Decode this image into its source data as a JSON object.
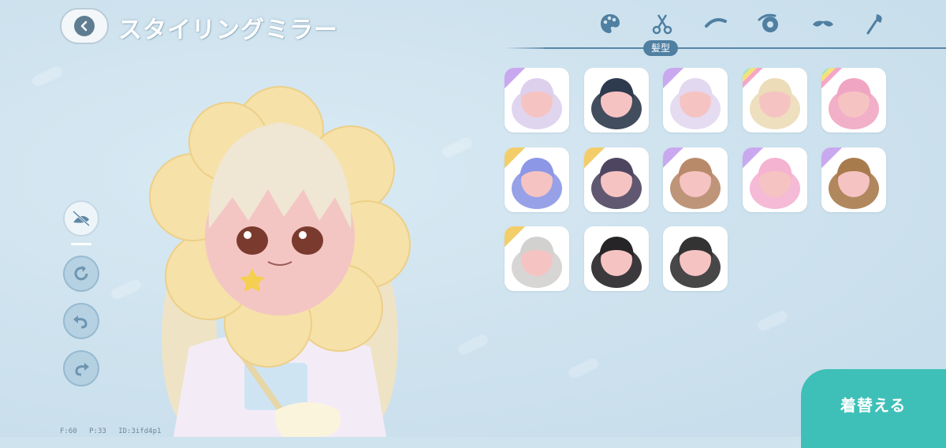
{
  "header": {
    "title": "スタイリングミラー"
  },
  "tabs": {
    "items": [
      {
        "icon": "palette-icon"
      },
      {
        "icon": "scissors-icon"
      },
      {
        "icon": "eyebrow-icon"
      },
      {
        "icon": "eye-icon"
      },
      {
        "icon": "mustache-icon"
      },
      {
        "icon": "brush-icon"
      }
    ],
    "active_label": "髪型"
  },
  "hair_items": [
    {
      "style": "lavender-twin-buns",
      "hair": "#ddd0ec",
      "corner": "purple"
    },
    {
      "style": "black-spiky",
      "hair": "#2e3a4d",
      "corner": "none"
    },
    {
      "style": "lavender-curly",
      "hair": "#e2d8ef",
      "corner": "purple"
    },
    {
      "style": "blonde-long-twin",
      "hair": "#ecdcb8",
      "corner": "rainbow"
    },
    {
      "style": "pink-shaggy",
      "hair": "#f0a6c2",
      "corner": "rainbow"
    },
    {
      "style": "blue-purple-bob",
      "hair": "#8c97e6",
      "corner": "gold"
    },
    {
      "style": "dark-purple-long",
      "hair": "#4e4661",
      "corner": "gold"
    },
    {
      "style": "brown-wavy-long",
      "hair": "#b88a6a",
      "corner": "purple"
    },
    {
      "style": "pink-wavy-long",
      "hair": "#f4b3d0",
      "corner": "purple"
    },
    {
      "style": "brown-messy",
      "hair": "#a87b4c",
      "corner": "purple"
    },
    {
      "style": "silver-braids",
      "hair": "#d3d1cf",
      "corner": "gold"
    },
    {
      "style": "black-updo",
      "hair": "#262427",
      "corner": "none"
    },
    {
      "style": "black-grey-undercut",
      "hair": "#333333",
      "corner": "none"
    }
  ],
  "tools": [
    {
      "icon": "hide-hat-icon",
      "state": "active"
    },
    {
      "icon": "reset-icon",
      "state": "idle"
    },
    {
      "icon": "undo-icon",
      "state": "idle"
    },
    {
      "icon": "redo-icon",
      "state": "idle"
    }
  ],
  "confirm": {
    "label": "着替える"
  },
  "debug": {
    "f": "F:60",
    "p": "P:33",
    "id": "ID:3ifd4p1"
  },
  "colors": {
    "accent": "#3ec0b8",
    "tab_line": "#5b86a6",
    "title_text": "#ffffff"
  }
}
